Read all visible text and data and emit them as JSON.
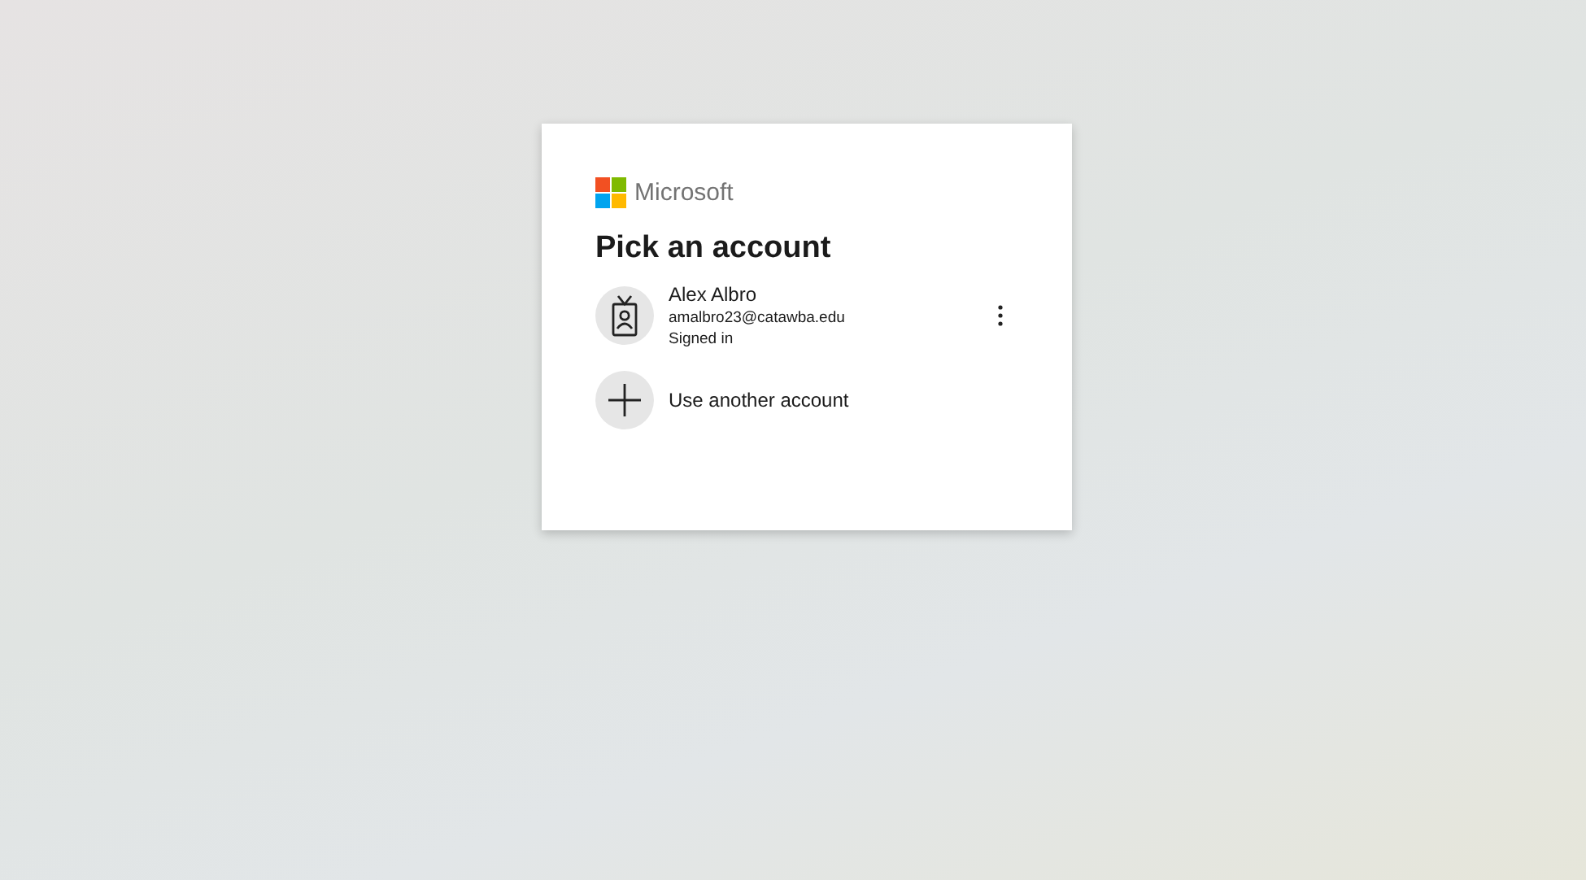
{
  "brand": "Microsoft",
  "title": "Pick an account",
  "accounts": [
    {
      "kind": "account",
      "name": "Alex Albro",
      "email": "amalbro23@catawba.edu",
      "status": "Signed in"
    },
    {
      "kind": "add",
      "label": "Use another account"
    }
  ]
}
